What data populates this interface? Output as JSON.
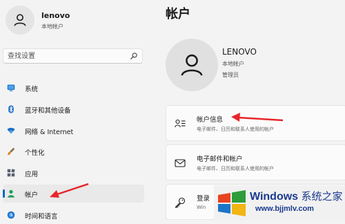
{
  "profile": {
    "name": "lenovo",
    "type": "本地帐户"
  },
  "search": {
    "placeholder": "查找设置"
  },
  "sidebar": {
    "items": [
      {
        "label": "系统",
        "icon": "monitor-icon"
      },
      {
        "label": "蓝牙和其他设备",
        "icon": "bluetooth-icon"
      },
      {
        "label": "网络 & Internet",
        "icon": "wifi-icon"
      },
      {
        "label": "个性化",
        "icon": "brush-icon"
      },
      {
        "label": "应用",
        "icon": "apps-icon"
      },
      {
        "label": "帐户",
        "icon": "person-icon",
        "active": true
      },
      {
        "label": "时间和语言",
        "icon": "globe-clock-icon"
      }
    ]
  },
  "main": {
    "title": "帐户",
    "account": {
      "name": "LENOVO",
      "type": "本地帐户",
      "role": "管理员"
    },
    "cards": [
      {
        "title": "帐户信息",
        "desc": "电子邮件、日历和联系人使用的帐户",
        "icon": "account-info-icon"
      },
      {
        "title": "电子邮件和帐户",
        "desc": "电子邮件、日历和联系人使用的帐户",
        "icon": "mail-icon"
      },
      {
        "title": "登录",
        "desc": "Win",
        "icon": "key-icon"
      }
    ]
  },
  "watermark": {
    "title": "Windows",
    "title_cn": "系统之家",
    "url": "www.bjjmlv.com"
  },
  "colors": {
    "accent": "#0067c0",
    "arrow": "#e8262a",
    "watermark": "#1a3a8c"
  }
}
